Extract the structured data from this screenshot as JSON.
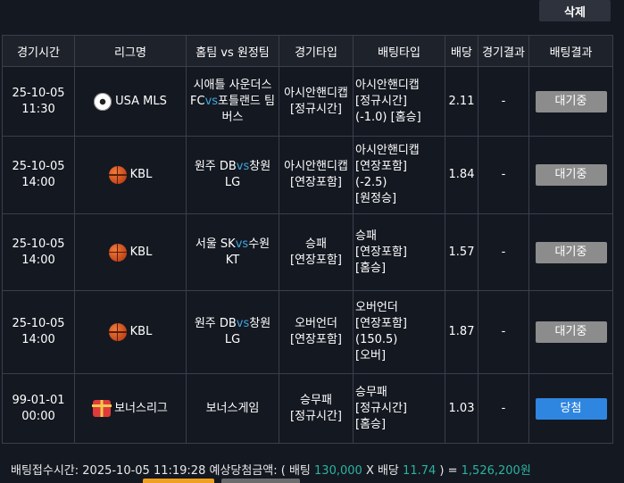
{
  "toolbar": {
    "delete_label": "삭제"
  },
  "table": {
    "headers": [
      "경기시간",
      "리그명",
      "홈팀 vs 원정팀",
      "경기타입",
      "배팅타입",
      "배당",
      "경기결과",
      "배팅결과"
    ],
    "vs": "vs",
    "rows": [
      {
        "date": "25-10-05",
        "time": "11:30",
        "league_icon": "soccer-ball-icon",
        "league": "USA MLS",
        "home": "시애틀 사운더스 FC",
        "away": "포틀랜드 팀버스",
        "game_type": [
          "아시안핸디캡",
          "[정규시간]"
        ],
        "bet_type": [
          "아시안핸디캡",
          "[정규시간]",
          "(-1.0) [홈승]"
        ],
        "odds": "2.11",
        "result": "-",
        "status": "대기중"
      },
      {
        "date": "25-10-05",
        "time": "14:00",
        "league_icon": "basketball-icon",
        "league": "KBL",
        "home": "원주 DB",
        "away": "창원 LG",
        "game_type": [
          "아시안핸디캡",
          "[연장포함]"
        ],
        "bet_type": [
          "아시안핸디캡",
          "[연장포함]",
          "(-2.5)",
          "[원정승]"
        ],
        "odds": "1.84",
        "result": "-",
        "status": "대기중"
      },
      {
        "date": "25-10-05",
        "time": "14:00",
        "league_icon": "basketball-icon",
        "league": "KBL",
        "home": "서울 SK",
        "away": "수원 KT",
        "game_type": [
          "승패",
          "[연장포함]"
        ],
        "bet_type": [
          "승패",
          "[연장포함]",
          "[홈승]"
        ],
        "odds": "1.57",
        "result": "-",
        "status": "대기중"
      },
      {
        "date": "25-10-05",
        "time": "14:00",
        "league_icon": "basketball-icon",
        "league": "KBL",
        "home": "원주 DB",
        "away": "창원 LG",
        "game_type": [
          "오버언더",
          "[연장포함]"
        ],
        "bet_type": [
          "오버언더",
          "[연장포함]",
          "(150.5)",
          "[오버]"
        ],
        "odds": "1.87",
        "result": "-",
        "status": "대기중"
      },
      {
        "date": "99-01-01",
        "time": "00:00",
        "league_icon": "gift-box-icon",
        "league": "보너스리그",
        "match": "보너스게임",
        "game_type": [
          "승무패",
          "[정규시간]"
        ],
        "bet_type": [
          "승무패",
          "[정규시간]",
          "[홈승]"
        ],
        "odds": "1.03",
        "result": "-",
        "status": "당첨"
      }
    ]
  },
  "summary": {
    "time_label": "배팅접수시간: 2025-10-05 11:19:28",
    "expected_label": "예상당첨금액: ( 배팅",
    "bet_amount": "130,000",
    "x_label": "X 배당",
    "total_odds": "11.74",
    "eq_label": ") =",
    "payout": "1,526,200원"
  },
  "colors": {
    "background": "#141821",
    "accent_blue": "#3fa7e0",
    "pending_gray": "#8c8c8c",
    "win_blue": "#2f86e0",
    "amount_green": "#2ab3a0"
  }
}
